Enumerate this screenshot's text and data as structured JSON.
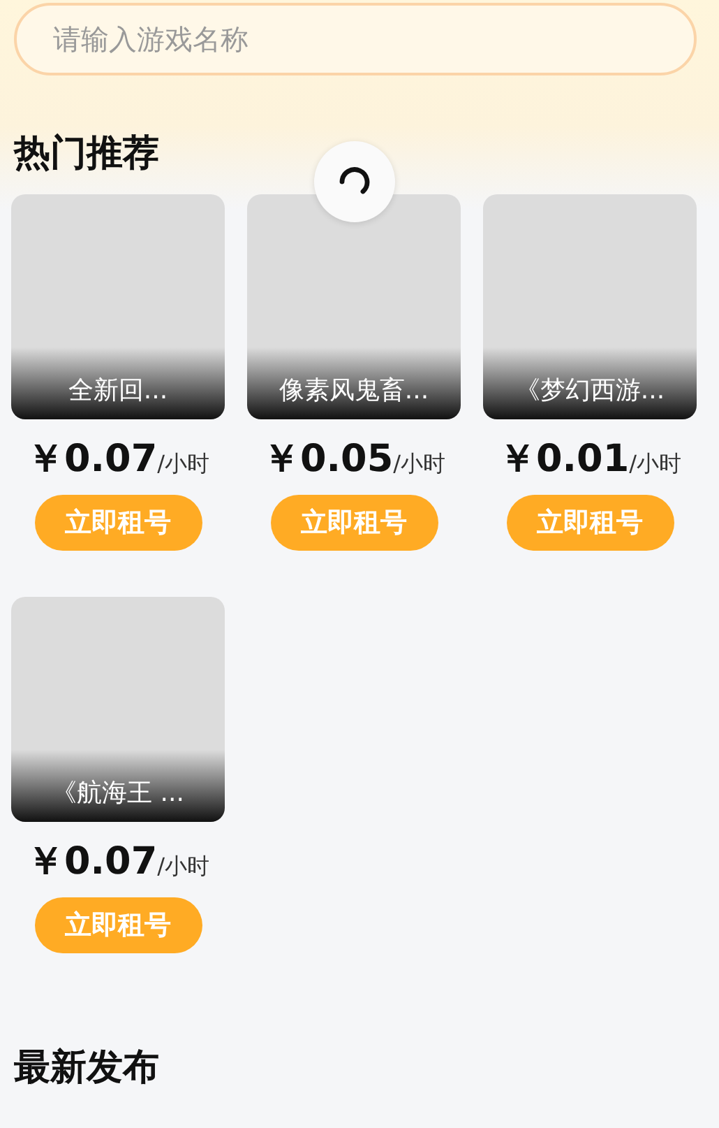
{
  "search": {
    "placeholder": "请输入游戏名称"
  },
  "hot": {
    "title": "热门推荐",
    "items": [
      {
        "name": "全新回...",
        "price": "￥0.07",
        "unit": "/小时",
        "button": "立即租号"
      },
      {
        "name": "像素风鬼畜...",
        "price": "￥0.05",
        "unit": "/小时",
        "button": "立即租号"
      },
      {
        "name": "《梦幻西游...",
        "price": "￥0.01",
        "unit": "/小时",
        "button": "立即租号"
      },
      {
        "name": "《航海王 ...",
        "price": "￥0.07",
        "unit": "/小时",
        "button": "立即租号"
      }
    ]
  },
  "loading": true,
  "latest": {
    "title": "最新发布"
  }
}
